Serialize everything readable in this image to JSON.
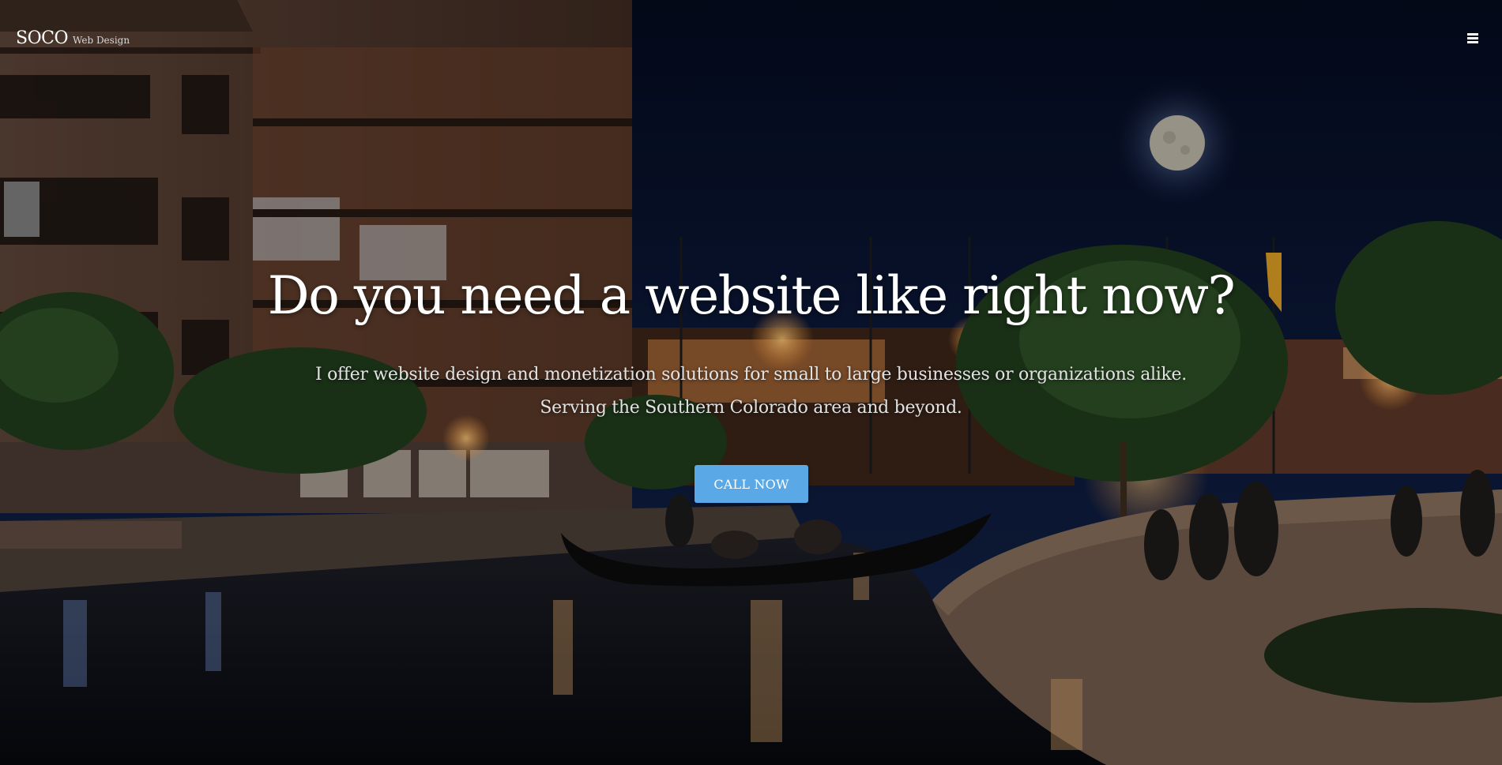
{
  "brand": {
    "name": "SOCO",
    "tagline": "Web Design"
  },
  "nav": {
    "menu_icon": "hamburger-menu-icon"
  },
  "hero": {
    "headline": "Do you need a website like right now?",
    "subtext_line1": "I offer website design and monetization solutions for small to large businesses or organizations alike.",
    "subtext_line2": "Serving the Southern Colorado area and beyond.",
    "cta_label": "CALL NOW",
    "background": "Night photo of a riverwalk with a gondola, buildings, trees, people, and a full moon"
  },
  "colors": {
    "accent": "#5aa9e6",
    "text": "#ffffff",
    "sky": "#07122a"
  }
}
